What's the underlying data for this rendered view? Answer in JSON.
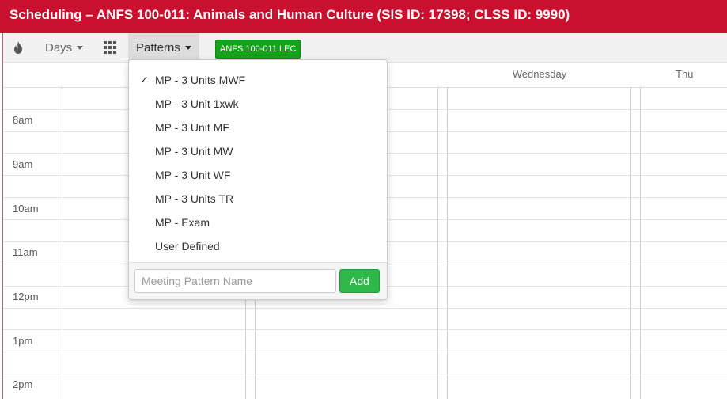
{
  "window": {
    "title": "Scheduling – ANFS 100-011: Animals and Human Culture (SIS ID: 17398; CLSS ID: 9990)"
  },
  "toolbar": {
    "fire_icon": "fire-icon",
    "days_label": "Days",
    "grid_icon": "grid-icon",
    "patterns_label": "Patterns",
    "section_badge": "ANFS 100-011 LEC",
    "badge_color": "#17a21b"
  },
  "calendar": {
    "days": [
      "Wednesday",
      "Thu"
    ],
    "times": [
      "8am",
      "9am",
      "10am",
      "11am",
      "12pm",
      "1pm",
      "2pm"
    ]
  },
  "patterns_menu": {
    "items": [
      {
        "label": "MP - 3 Units MWF",
        "checked": true
      },
      {
        "label": "MP - 3 Unit 1xwk",
        "checked": false
      },
      {
        "label": "MP - 3 Unit MF",
        "checked": false
      },
      {
        "label": "MP - 3 Unit MW",
        "checked": false
      },
      {
        "label": "MP - 3 Unit WF",
        "checked": false
      },
      {
        "label": "MP - 3 Units TR",
        "checked": false
      },
      {
        "label": "MP - Exam",
        "checked": false
      },
      {
        "label": "User Defined",
        "checked": false
      }
    ],
    "check_mark": "✓",
    "name_placeholder": "Meeting Pattern Name",
    "name_value": "",
    "add_label": "Add"
  }
}
